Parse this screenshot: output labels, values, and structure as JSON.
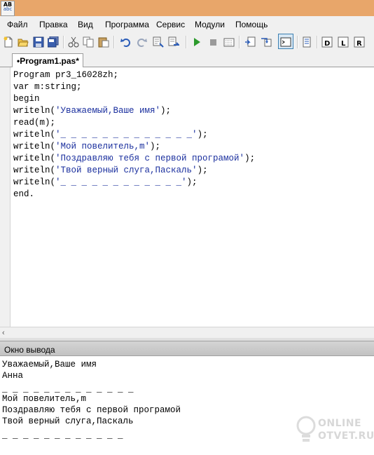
{
  "app": {
    "icon_top": "AB",
    "icon_bottom": "abc"
  },
  "menu": [
    "Файл",
    "Правка",
    "Вид",
    "Программа",
    "Сервис",
    "Модули",
    "Помощь"
  ],
  "toolbar_icons": [
    "new-file-icon",
    "open-folder-icon",
    "save-icon",
    "save-all-icon",
    "cut-icon",
    "copy-icon",
    "paste-icon",
    "undo-icon",
    "redo-icon",
    "find-icon",
    "replace-icon",
    "run-icon",
    "stop-icon",
    "debug-icon",
    "step-icon",
    "step-over-icon",
    "output-window-icon",
    "properties-icon",
    "module-d-icon",
    "module-l-icon",
    "module-r-icon"
  ],
  "tab": {
    "label": "•Program1.pas*"
  },
  "editor": {
    "lines": [
      "Program pr3_16028zh;",
      "var m:string;",
      "begin",
      "writeln('Уважаемый,Ваше имя');",
      "read(m);",
      "writeln('_ _ _ _ _ _ _ _ _ _ _ _ _');",
      "writeln('Мой повелитель,m');",
      "writeln('Поздравляю тебя с первой програмой');",
      "writeln('Твой верный слуга,Паскаль');",
      "writeln('_ _ _ _ _ _ _ _ _ _ _ _');",
      "end."
    ]
  },
  "output_panel": {
    "title": "Окно вывода",
    "lines": [
      "Уважаемый,Ваше имя",
      "Анна",
      "_ _ _ _ _ _ _ _ _ _ _ _ _",
      "Мой повелитель,m",
      "Поздравляю тебя с первой програмой",
      "Твой верный слуга,Паскаль",
      "_ _ _ _ _ _ _ _ _ _ _ _"
    ]
  },
  "watermark": {
    "line1": "ONLINE",
    "line2": "OTVET.RU"
  },
  "colors": {
    "titlebar": "#e8a66a",
    "string": "#1a2f9e",
    "chrome": "#f0f0f0"
  }
}
